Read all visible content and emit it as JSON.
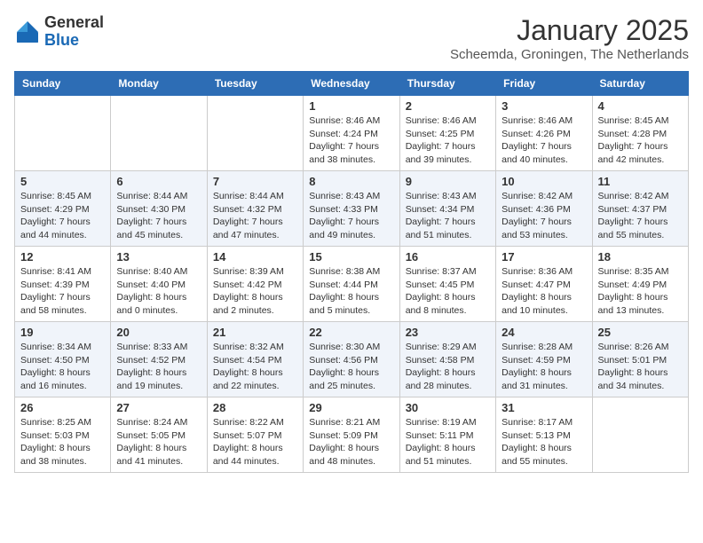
{
  "header": {
    "logo_general": "General",
    "logo_blue": "Blue",
    "month": "January 2025",
    "location": "Scheemda, Groningen, The Netherlands"
  },
  "days_of_week": [
    "Sunday",
    "Monday",
    "Tuesday",
    "Wednesday",
    "Thursday",
    "Friday",
    "Saturday"
  ],
  "weeks": [
    [
      {
        "day": "",
        "info": ""
      },
      {
        "day": "",
        "info": ""
      },
      {
        "day": "",
        "info": ""
      },
      {
        "day": "1",
        "info": "Sunrise: 8:46 AM\nSunset: 4:24 PM\nDaylight: 7 hours and 38 minutes."
      },
      {
        "day": "2",
        "info": "Sunrise: 8:46 AM\nSunset: 4:25 PM\nDaylight: 7 hours and 39 minutes."
      },
      {
        "day": "3",
        "info": "Sunrise: 8:46 AM\nSunset: 4:26 PM\nDaylight: 7 hours and 40 minutes."
      },
      {
        "day": "4",
        "info": "Sunrise: 8:45 AM\nSunset: 4:28 PM\nDaylight: 7 hours and 42 minutes."
      }
    ],
    [
      {
        "day": "5",
        "info": "Sunrise: 8:45 AM\nSunset: 4:29 PM\nDaylight: 7 hours and 44 minutes."
      },
      {
        "day": "6",
        "info": "Sunrise: 8:44 AM\nSunset: 4:30 PM\nDaylight: 7 hours and 45 minutes."
      },
      {
        "day": "7",
        "info": "Sunrise: 8:44 AM\nSunset: 4:32 PM\nDaylight: 7 hours and 47 minutes."
      },
      {
        "day": "8",
        "info": "Sunrise: 8:43 AM\nSunset: 4:33 PM\nDaylight: 7 hours and 49 minutes."
      },
      {
        "day": "9",
        "info": "Sunrise: 8:43 AM\nSunset: 4:34 PM\nDaylight: 7 hours and 51 minutes."
      },
      {
        "day": "10",
        "info": "Sunrise: 8:42 AM\nSunset: 4:36 PM\nDaylight: 7 hours and 53 minutes."
      },
      {
        "day": "11",
        "info": "Sunrise: 8:42 AM\nSunset: 4:37 PM\nDaylight: 7 hours and 55 minutes."
      }
    ],
    [
      {
        "day": "12",
        "info": "Sunrise: 8:41 AM\nSunset: 4:39 PM\nDaylight: 7 hours and 58 minutes."
      },
      {
        "day": "13",
        "info": "Sunrise: 8:40 AM\nSunset: 4:40 PM\nDaylight: 8 hours and 0 minutes."
      },
      {
        "day": "14",
        "info": "Sunrise: 8:39 AM\nSunset: 4:42 PM\nDaylight: 8 hours and 2 minutes."
      },
      {
        "day": "15",
        "info": "Sunrise: 8:38 AM\nSunset: 4:44 PM\nDaylight: 8 hours and 5 minutes."
      },
      {
        "day": "16",
        "info": "Sunrise: 8:37 AM\nSunset: 4:45 PM\nDaylight: 8 hours and 8 minutes."
      },
      {
        "day": "17",
        "info": "Sunrise: 8:36 AM\nSunset: 4:47 PM\nDaylight: 8 hours and 10 minutes."
      },
      {
        "day": "18",
        "info": "Sunrise: 8:35 AM\nSunset: 4:49 PM\nDaylight: 8 hours and 13 minutes."
      }
    ],
    [
      {
        "day": "19",
        "info": "Sunrise: 8:34 AM\nSunset: 4:50 PM\nDaylight: 8 hours and 16 minutes."
      },
      {
        "day": "20",
        "info": "Sunrise: 8:33 AM\nSunset: 4:52 PM\nDaylight: 8 hours and 19 minutes."
      },
      {
        "day": "21",
        "info": "Sunrise: 8:32 AM\nSunset: 4:54 PM\nDaylight: 8 hours and 22 minutes."
      },
      {
        "day": "22",
        "info": "Sunrise: 8:30 AM\nSunset: 4:56 PM\nDaylight: 8 hours and 25 minutes."
      },
      {
        "day": "23",
        "info": "Sunrise: 8:29 AM\nSunset: 4:58 PM\nDaylight: 8 hours and 28 minutes."
      },
      {
        "day": "24",
        "info": "Sunrise: 8:28 AM\nSunset: 4:59 PM\nDaylight: 8 hours and 31 minutes."
      },
      {
        "day": "25",
        "info": "Sunrise: 8:26 AM\nSunset: 5:01 PM\nDaylight: 8 hours and 34 minutes."
      }
    ],
    [
      {
        "day": "26",
        "info": "Sunrise: 8:25 AM\nSunset: 5:03 PM\nDaylight: 8 hours and 38 minutes."
      },
      {
        "day": "27",
        "info": "Sunrise: 8:24 AM\nSunset: 5:05 PM\nDaylight: 8 hours and 41 minutes."
      },
      {
        "day": "28",
        "info": "Sunrise: 8:22 AM\nSunset: 5:07 PM\nDaylight: 8 hours and 44 minutes."
      },
      {
        "day": "29",
        "info": "Sunrise: 8:21 AM\nSunset: 5:09 PM\nDaylight: 8 hours and 48 minutes."
      },
      {
        "day": "30",
        "info": "Sunrise: 8:19 AM\nSunset: 5:11 PM\nDaylight: 8 hours and 51 minutes."
      },
      {
        "day": "31",
        "info": "Sunrise: 8:17 AM\nSunset: 5:13 PM\nDaylight: 8 hours and 55 minutes."
      },
      {
        "day": "",
        "info": ""
      }
    ]
  ]
}
